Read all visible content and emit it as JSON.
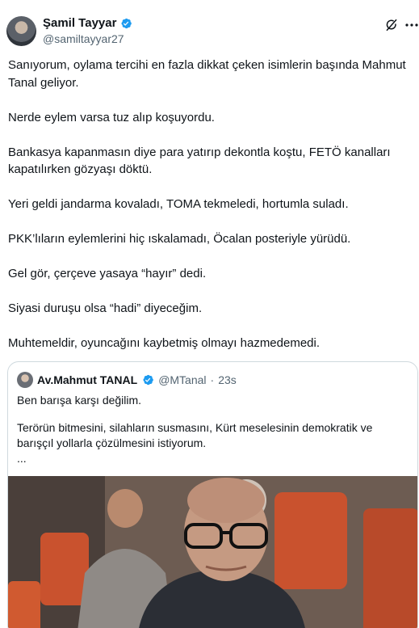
{
  "tweet": {
    "author": {
      "display_name": "Şamil Tayyar",
      "handle": "@samiltayyar27",
      "verified_color": "#1d9bf0"
    },
    "icons": {
      "grok": "grok-icon",
      "more": "more-icon",
      "verified": "verified-badge-icon"
    },
    "paragraphs": [
      "Sanıyorum, oylama tercihi en fazla dikkat çeken isimlerin başında Mahmut Tanal geliyor.",
      "Nerde eylem varsa tuz alıp koşuyordu.",
      "Bankasya kapanmasın diye para yatırıp dekontla koştu, FETÖ kanalları kapatılırken gözyaşı döktü.",
      "Yeri geldi jandarma kovaladı, TOMA tekmeledi, hortumla suladı.",
      "PKK’lıların eylemlerini hiç ıskalamadı, Öcalan posteriyle yürüdü.",
      "Gel gör, çerçeve yasaya “hayır” dedi.",
      "Siyasi duruşu olsa “hadi” diyeceğim.",
      "Muhtemeldir, oyuncağını kaybetmiş olmayı hazmedemedi."
    ],
    "quote": {
      "display_name": "Av.Mahmut TANAL",
      "handle": "@MTanal",
      "separator": "·",
      "time": "23s",
      "paragraphs": [
        "Ben barışa karşı değilim.",
        "Terörün bitmesini, silahların susmasını, Kürt meselesinin demokratik ve barışçıl yollarla çözülmesini istiyorum.",
        "..."
      ]
    }
  },
  "colors": {
    "text": "#0f1419",
    "secondary": "#536471",
    "border": "#cfd9de",
    "accent": "#1d9bf0"
  }
}
